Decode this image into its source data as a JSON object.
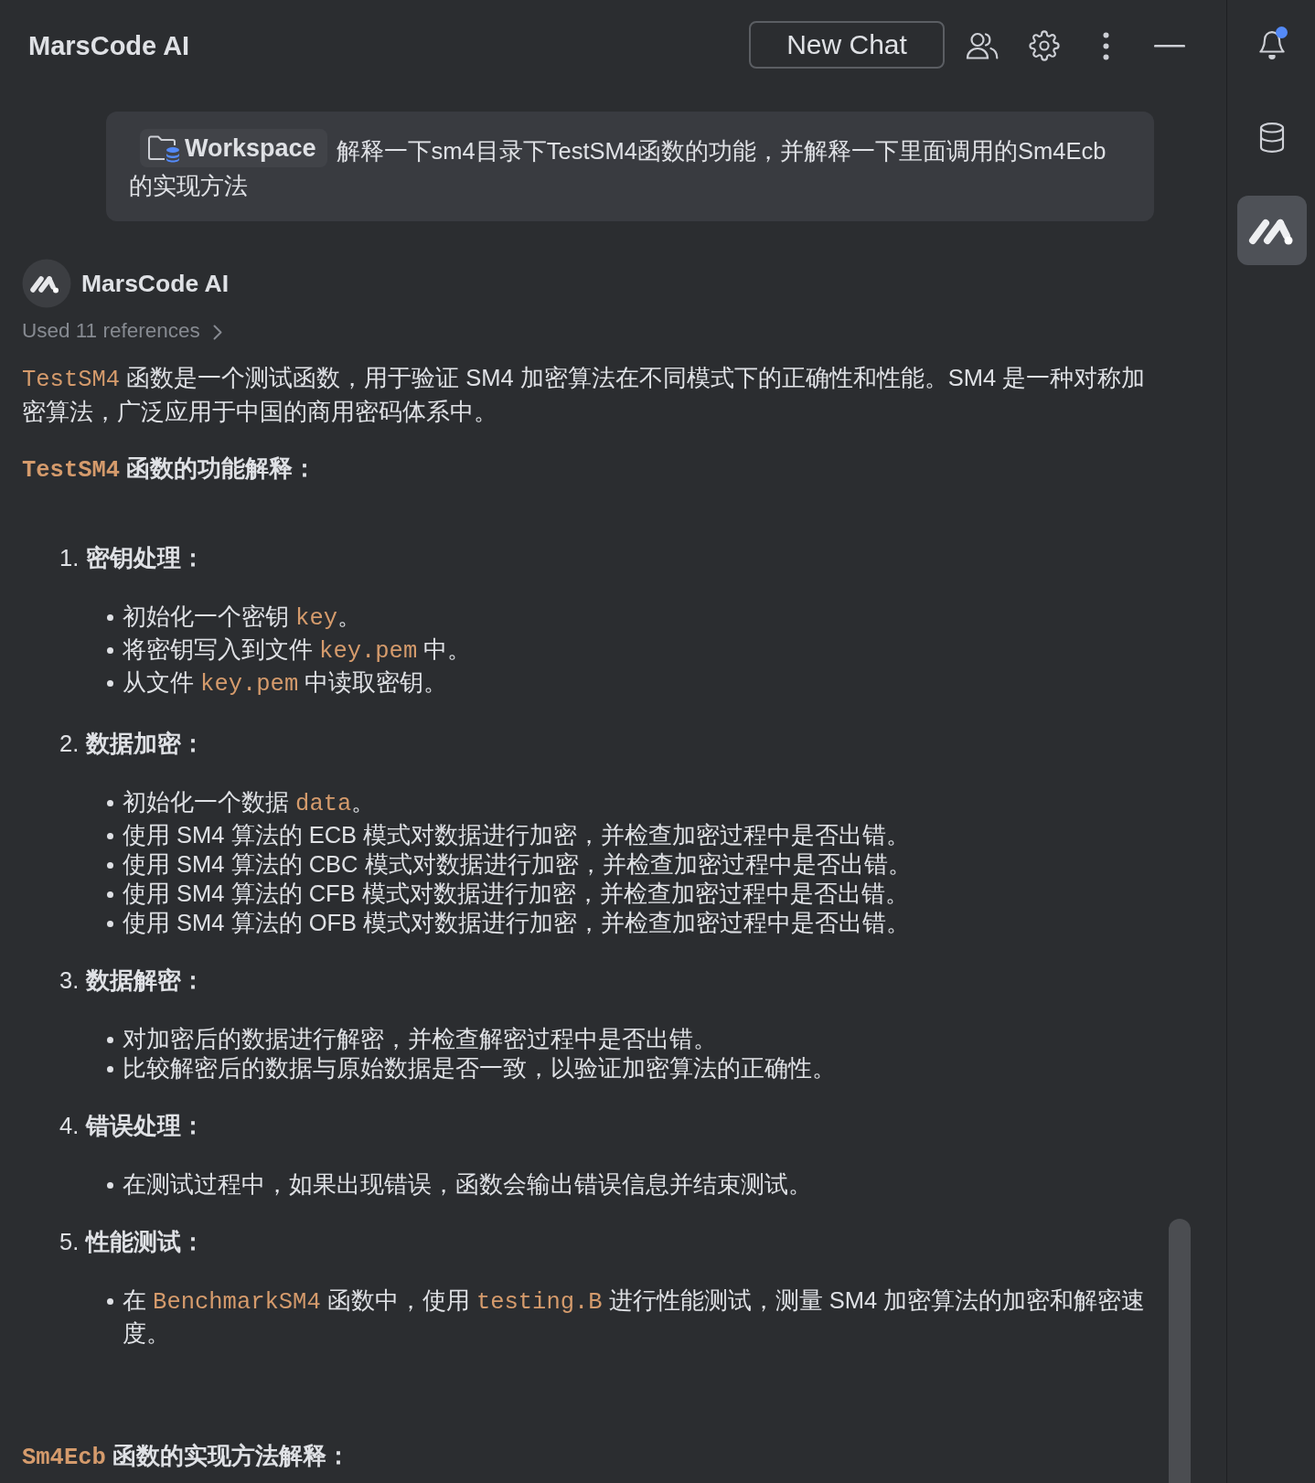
{
  "header": {
    "title": "MarsCode AI",
    "new_chat_button": "New Chat"
  },
  "sidebar": {
    "items": [
      {
        "kind": "notifications",
        "selected": false,
        "unread": true
      },
      {
        "kind": "database",
        "selected": false,
        "unread": false
      },
      {
        "kind": "assistant",
        "selected": true,
        "unread": false
      }
    ]
  },
  "user_message": {
    "context_chip": "Workspace",
    "lines": [
      "解释一下sm4目录下TestSM4函数的功能，并解释一下里面调用的Sm4Ecb",
      "的实现方法"
    ]
  },
  "assistant_message": {
    "name": "MarsCode AI",
    "references": "Used 11 references",
    "blocks": [
      {
        "kind": "paragraph",
        "segments": [
          {
            "kind": "code",
            "text": "TestSM4"
          },
          {
            "kind": "text",
            "text": " 函数是一个测试函数，用于验证 SM4 加密算法在不同模式下的正确性和性能。SM4 是一种对称加密算法，广泛应用于中国的商用密码体系中。"
          }
        ]
      },
      {
        "kind": "heading",
        "segments": [
          {
            "kind": "code",
            "text": "TestSM4"
          },
          {
            "kind": "text",
            "text": " 函数的功能解释："
          }
        ]
      },
      {
        "kind": "ordered_list",
        "items": [
          {
            "number": "1.",
            "title": "密钥处理：",
            "bullets": [
              {
                "segments": [
                  {
                    "kind": "text",
                    "text": "初始化一个密钥 "
                  },
                  {
                    "kind": "code",
                    "text": "key"
                  },
                  {
                    "kind": "text",
                    "text": "。"
                  }
                ]
              },
              {
                "segments": [
                  {
                    "kind": "text",
                    "text": "将密钥写入到文件 "
                  },
                  {
                    "kind": "code",
                    "text": "key.pem"
                  },
                  {
                    "kind": "text",
                    "text": " 中。"
                  }
                ]
              },
              {
                "segments": [
                  {
                    "kind": "text",
                    "text": "从文件 "
                  },
                  {
                    "kind": "code",
                    "text": "key.pem"
                  },
                  {
                    "kind": "text",
                    "text": " 中读取密钥。"
                  }
                ]
              }
            ]
          },
          {
            "number": "2.",
            "title": "数据加密：",
            "bullets": [
              {
                "segments": [
                  {
                    "kind": "text",
                    "text": "初始化一个数据 "
                  },
                  {
                    "kind": "code",
                    "text": "data"
                  },
                  {
                    "kind": "text",
                    "text": "。"
                  }
                ]
              },
              {
                "segments": [
                  {
                    "kind": "text",
                    "text": "使用 SM4 算法的 ECB 模式对数据进行加密，并检查加密过程中是否出错。"
                  }
                ]
              },
              {
                "segments": [
                  {
                    "kind": "text",
                    "text": "使用 SM4 算法的 CBC 模式对数据进行加密，并检查加密过程中是否出错。"
                  }
                ]
              },
              {
                "segments": [
                  {
                    "kind": "text",
                    "text": "使用 SM4 算法的 CFB 模式对数据进行加密，并检查加密过程中是否出错。"
                  }
                ]
              },
              {
                "segments": [
                  {
                    "kind": "text",
                    "text": "使用 SM4 算法的 OFB 模式对数据进行加密，并检查加密过程中是否出错。"
                  }
                ]
              }
            ]
          },
          {
            "number": "3.",
            "title": "数据解密：",
            "bullets": [
              {
                "segments": [
                  {
                    "kind": "text",
                    "text": "对加密后的数据进行解密，并检查解密过程中是否出错。"
                  }
                ]
              },
              {
                "segments": [
                  {
                    "kind": "text",
                    "text": "比较解密后的数据与原始数据是否一致，以验证加密算法的正确性。"
                  }
                ]
              }
            ]
          },
          {
            "number": "4.",
            "title": "错误处理：",
            "bullets": [
              {
                "segments": [
                  {
                    "kind": "text",
                    "text": "在测试过程中，如果出现错误，函数会输出错误信息并结束测试。"
                  }
                ]
              }
            ]
          },
          {
            "number": "5.",
            "title": "性能测试：",
            "bullets": [
              {
                "segments": [
                  {
                    "kind": "text",
                    "text": "在 "
                  },
                  {
                    "kind": "code",
                    "text": "BenchmarkSM4"
                  },
                  {
                    "kind": "text",
                    "text": " 函数中，使用 "
                  },
                  {
                    "kind": "code",
                    "text": "testing.B"
                  },
                  {
                    "kind": "text",
                    "text": " 进行性能测试，测量 SM4 加密算法的加密和解密速度。"
                  }
                ]
              }
            ]
          }
        ]
      },
      {
        "kind": "heading",
        "segments": [
          {
            "kind": "code",
            "text": "Sm4Ecb"
          },
          {
            "kind": "text",
            "text": " 函数的实现方法解释："
          }
        ]
      }
    ]
  }
}
